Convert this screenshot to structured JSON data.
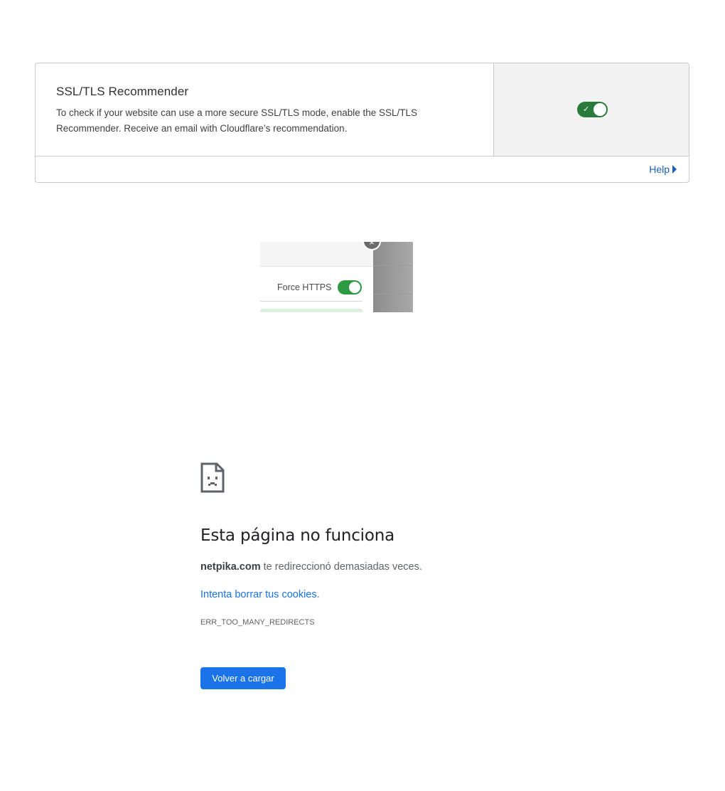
{
  "ssl_card": {
    "title": "SSL/TLS Recommender",
    "description": "To check if your website can use a more secure SSL/TLS mode, enable the SSL/TLS Recommender. Receive an email with Cloudflare’s recommendation.",
    "toggle_state": "on",
    "help_label": "Help",
    "colors": {
      "toggle_on": "#2a7a3b",
      "link": "#1c5fb4"
    }
  },
  "fragment": {
    "force_https_label": "Force HTTPS",
    "toggle_state": "on",
    "close_glyph": "×"
  },
  "error_page": {
    "icon": "sad-document-icon",
    "title": "Esta página no funciona",
    "domain": "netpika.com",
    "message_rest": " te redireccionó demasiadas veces.",
    "suggestion_link": "Intenta borrar tus cookies.",
    "error_code": "ERR_TOO_MANY_REDIRECTS",
    "reload_button": "Volver a cargar",
    "colors": {
      "button": "#1a73e8",
      "link": "#1a73e8"
    }
  }
}
